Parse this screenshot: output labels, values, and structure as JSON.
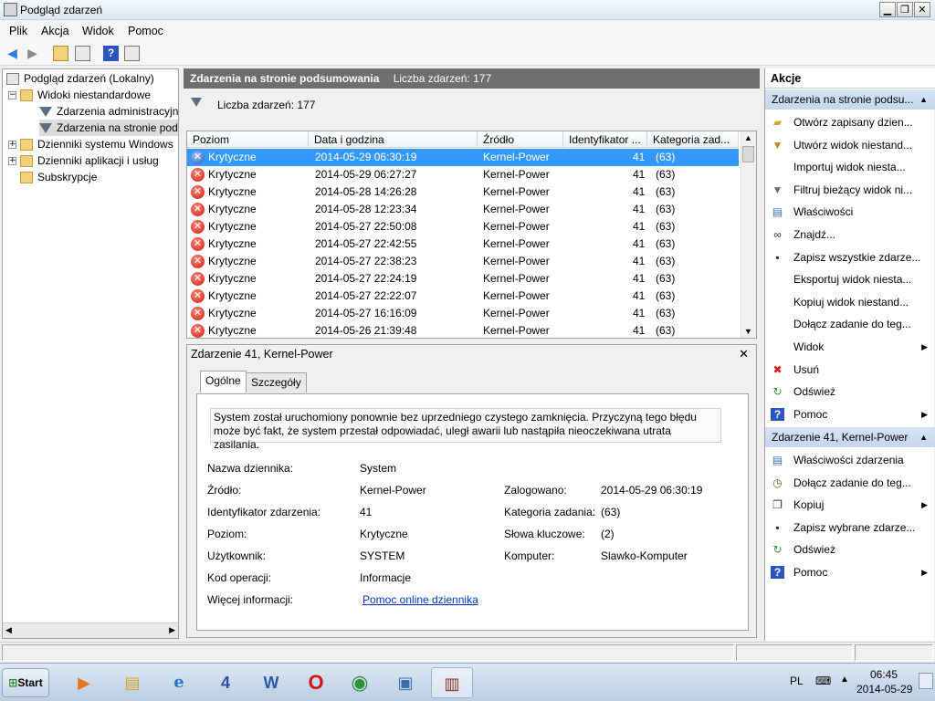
{
  "window": {
    "title": "Podgląd zdarzeń"
  },
  "menu": [
    "Plik",
    "Akcja",
    "Widok",
    "Pomoc"
  ],
  "tree": {
    "root": "Podgląd zdarzeń (Lokalny)",
    "custom_views": "Widoki niestandardowe",
    "admin_events": "Zdarzenia administracyjn",
    "summary_events": "Zdarzenia na stronie pod",
    "windows_logs": "Dzienniki systemu Windows",
    "app_logs": "Dzienniki aplikacji i usług",
    "subscriptions": "Subskrypcje"
  },
  "center": {
    "header_title": "Zdarzenia na stronie podsumowania",
    "header_count": "Liczba zdarzeń: 177",
    "count_label": "Liczba zdarzeń: 177"
  },
  "grid": {
    "columns": [
      "Poziom",
      "Data i godzina",
      "Źródło",
      "Identyfikator ...",
      "Kategoria zad..."
    ],
    "rows": [
      {
        "level": "Krytyczne",
        "date": "2014-05-29 06:30:19",
        "source": "Kernel-Power",
        "id": "41",
        "category": "(63)"
      },
      {
        "level": "Krytyczne",
        "date": "2014-05-29 06:27:27",
        "source": "Kernel-Power",
        "id": "41",
        "category": "(63)"
      },
      {
        "level": "Krytyczne",
        "date": "2014-05-28 14:26:28",
        "source": "Kernel-Power",
        "id": "41",
        "category": "(63)"
      },
      {
        "level": "Krytyczne",
        "date": "2014-05-28 12:23:34",
        "source": "Kernel-Power",
        "id": "41",
        "category": "(63)"
      },
      {
        "level": "Krytyczne",
        "date": "2014-05-27 22:50:08",
        "source": "Kernel-Power",
        "id": "41",
        "category": "(63)"
      },
      {
        "level": "Krytyczne",
        "date": "2014-05-27 22:42:55",
        "source": "Kernel-Power",
        "id": "41",
        "category": "(63)"
      },
      {
        "level": "Krytyczne",
        "date": "2014-05-27 22:38:23",
        "source": "Kernel-Power",
        "id": "41",
        "category": "(63)"
      },
      {
        "level": "Krytyczne",
        "date": "2014-05-27 22:24:19",
        "source": "Kernel-Power",
        "id": "41",
        "category": "(63)"
      },
      {
        "level": "Krytyczne",
        "date": "2014-05-27 22:22:07",
        "source": "Kernel-Power",
        "id": "41",
        "category": "(63)"
      },
      {
        "level": "Krytyczne",
        "date": "2014-05-27 16:16:09",
        "source": "Kernel-Power",
        "id": "41",
        "category": "(63)"
      },
      {
        "level": "Krytyczne",
        "date": "2014-05-26 21:39:48",
        "source": "Kernel-Power",
        "id": "41",
        "category": "(63)"
      }
    ]
  },
  "detail": {
    "title": "Zdarzenie 41, Kernel-Power",
    "tabs": [
      "Ogólne",
      "Szczegóły"
    ],
    "description": "System został uruchomiony ponownie bez uprzedniego czystego zamknięcia. Przyczyną tego błędu może być fakt, że system przestał odpowiadać, uległ awarii lub nastąpiła nieoczekiwana utrata zasilania.",
    "log_name_label": "Nazwa dziennika:",
    "log_name": "System",
    "source_label": "Źródło:",
    "source": "Kernel-Power",
    "logged_label": "Zalogowano:",
    "logged": "2014-05-29 06:30:19",
    "event_id_label": "Identyfikator zdarzenia:",
    "event_id": "41",
    "task_cat_label": "Kategoria zadania:",
    "task_cat": "(63)",
    "level_label": "Poziom:",
    "level": "Krytyczne",
    "keywords_label": "Słowa kluczowe:",
    "keywords": "(2)",
    "user_label": "Użytkownik:",
    "user": "SYSTEM",
    "computer_label": "Komputer:",
    "computer": "Slawko-Komputer",
    "opcode_label": "Kod operacji:",
    "opcode": "Informacje",
    "more_info_label": "Więcej informacji:",
    "more_info_link": "Pomoc online dziennika"
  },
  "actions": {
    "title": "Akcje",
    "section1": "Zdarzenia na stronie podsu...",
    "items1": [
      {
        "label": "Otwórz zapisany dzien...",
        "icon": "open-folder-icon",
        "arrow": false
      },
      {
        "label": "Utwórz widok niestand...",
        "icon": "create-filter-icon",
        "arrow": false
      },
      {
        "label": "Importuj widok niesta...",
        "icon": "",
        "arrow": false
      },
      {
        "label": "Filtruj bieżący widok ni...",
        "icon": "filter-icon",
        "arrow": false
      },
      {
        "label": "Właściwości",
        "icon": "properties-icon",
        "arrow": false
      },
      {
        "label": "Znajdź...",
        "icon": "binoculars-icon",
        "arrow": false
      },
      {
        "label": "Zapisz wszystkie zdarze...",
        "icon": "save-icon",
        "arrow": false
      },
      {
        "label": "Eksportuj widok niesta...",
        "icon": "",
        "arrow": false
      },
      {
        "label": "Kopiuj widok niestand...",
        "icon": "",
        "arrow": false
      },
      {
        "label": "Dołącz zadanie do teg...",
        "icon": "",
        "arrow": false
      },
      {
        "label": "Widok",
        "icon": "",
        "arrow": true
      },
      {
        "label": "Usuń",
        "icon": "delete-icon",
        "arrow": false
      },
      {
        "label": "Odśwież",
        "icon": "refresh-icon",
        "arrow": false
      },
      {
        "label": "Pomoc",
        "icon": "help-icon",
        "arrow": true
      }
    ],
    "section2": "Zdarzenie 41, Kernel-Power",
    "items2": [
      {
        "label": "Właściwości zdarzenia",
        "icon": "event-properties-icon",
        "arrow": false
      },
      {
        "label": "Dołącz zadanie do teg...",
        "icon": "attach-task-icon",
        "arrow": false
      },
      {
        "label": "Kopiuj",
        "icon": "copy-icon",
        "arrow": true
      },
      {
        "label": "Zapisz wybrane zdarze...",
        "icon": "save-icon",
        "arrow": false
      },
      {
        "label": "Odśwież",
        "icon": "refresh-icon",
        "arrow": false
      },
      {
        "label": "Pomoc",
        "icon": "help-icon",
        "arrow": true
      }
    ]
  },
  "taskbar": {
    "start": "Start",
    "lang": "PL",
    "time": "06:45",
    "date": "2014-05-29"
  }
}
